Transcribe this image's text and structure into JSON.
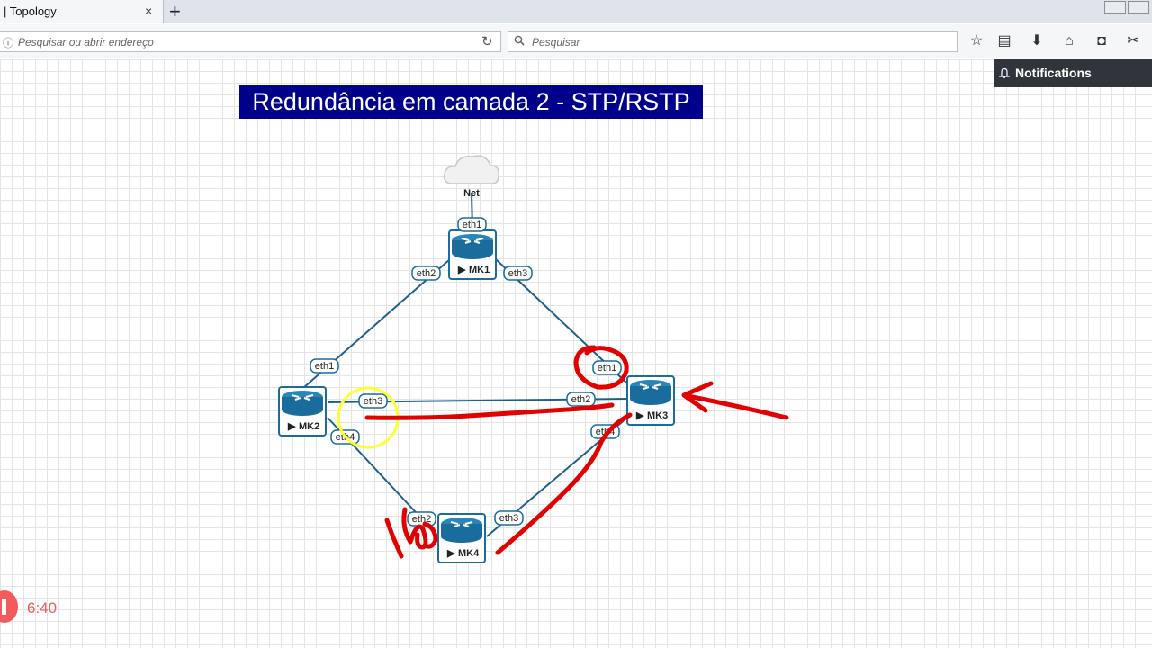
{
  "browser": {
    "tab_title": "| Topology",
    "tab_close": "×",
    "new_tab": "+",
    "url_placeholder": "Pesquisar ou abrir endereço",
    "search_placeholder": "Pesquisar",
    "icons": [
      "info-icon",
      "reload-icon",
      "search-icon",
      "bookmark-star-icon",
      "reading-list-icon",
      "download-icon",
      "home-icon",
      "pocket-icon",
      "screenshot-icon"
    ]
  },
  "notifications": {
    "label": "Notifications"
  },
  "topology": {
    "title": "Redundância em camada 2 - STP/RSTP",
    "cloud": {
      "label": "Net"
    },
    "nodes": [
      {
        "id": "mk1",
        "label": "MK1"
      },
      {
        "id": "mk2",
        "label": "MK2"
      },
      {
        "id": "mk3",
        "label": "MK3"
      },
      {
        "id": "mk4",
        "label": "MK4"
      }
    ],
    "ports": {
      "mk1_eth1": "eth1",
      "mk1_eth2": "eth2",
      "mk1_eth3": "eth3",
      "mk2_eth1": "eth1",
      "mk2_eth3": "eth3",
      "mk2_eth4": "eth4",
      "mk3_eth1": "eth1",
      "mk3_eth2": "eth2",
      "mk3_eth4": "eth4",
      "mk4_eth2": "eth2",
      "mk4_eth3": "eth3"
    },
    "colors": {
      "router": "#1a6c9c",
      "link": "#1e5f8a",
      "banner": "#00008b",
      "annotation": "#e30000",
      "highlight": "#ffff33"
    }
  },
  "recorder": {
    "time": "6:40"
  }
}
